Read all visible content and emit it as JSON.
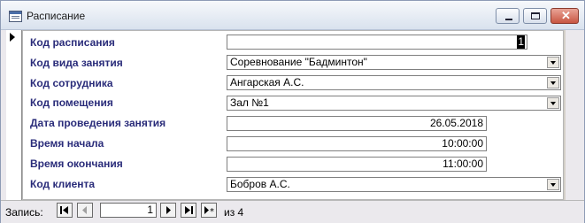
{
  "window": {
    "title": "Расписание"
  },
  "fields": [
    {
      "label": "Код расписания",
      "value": "1"
    },
    {
      "label": "Код вида занятия",
      "value": "Соревнование \"Бадминтон\""
    },
    {
      "label": "Код сотрудника",
      "value": "Ангарская А.С."
    },
    {
      "label": "Код помещения",
      "value": "Зал №1"
    },
    {
      "label": "Дата проведения занятия",
      "value": "26.05.2018"
    },
    {
      "label": "Время начала",
      "value": "10:00:00"
    },
    {
      "label": "Время окончания",
      "value": "11:00:00"
    },
    {
      "label": "Код клиента",
      "value": "Бобров А.С."
    }
  ],
  "navigation": {
    "label": "Запись:",
    "current": "1",
    "of_text": "из 4"
  }
}
